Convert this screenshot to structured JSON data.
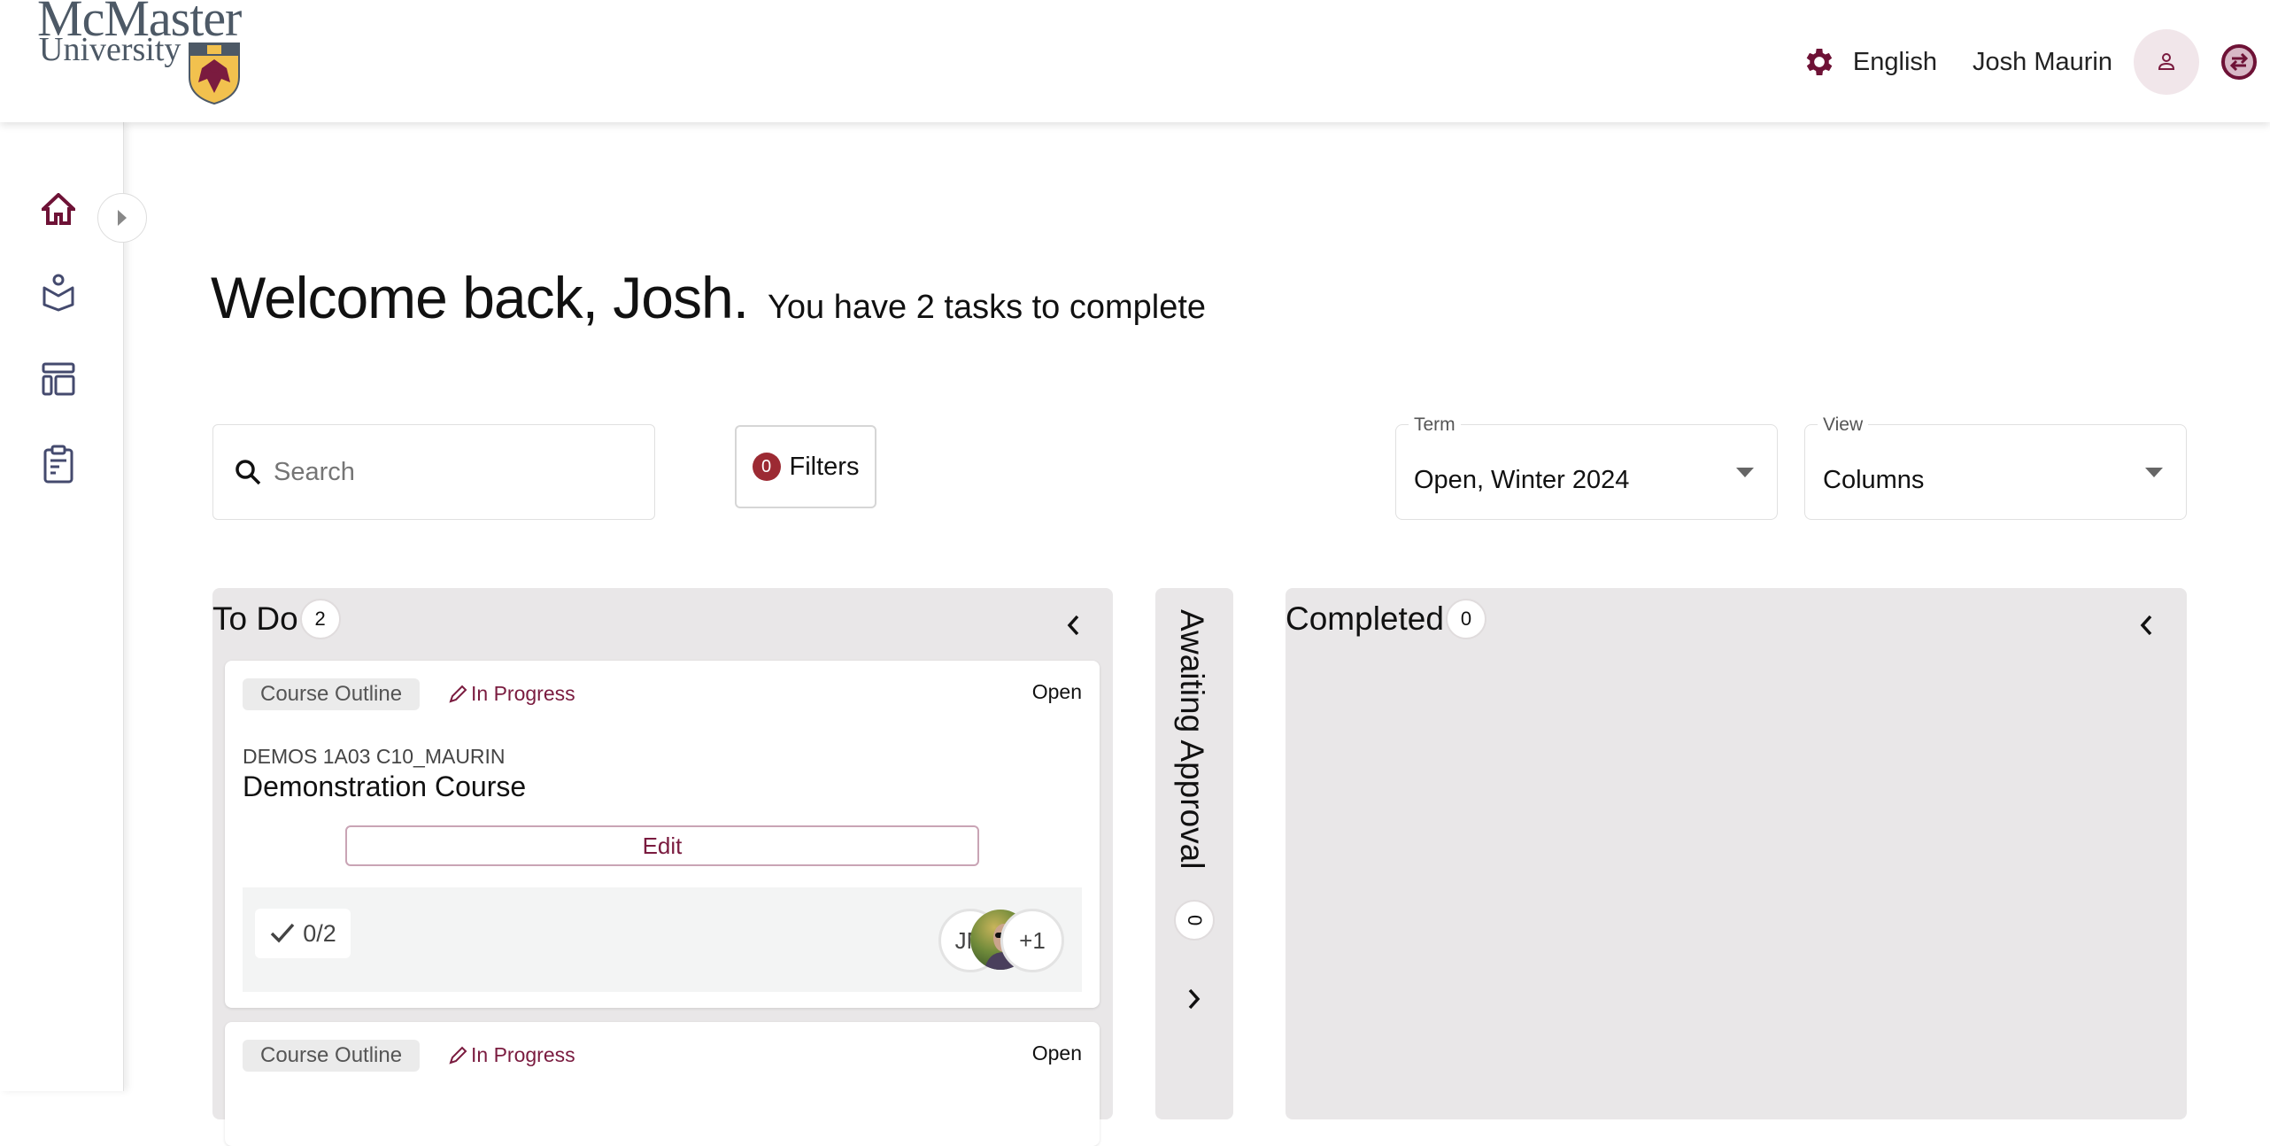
{
  "header": {
    "logo": {
      "line1": "McMaster",
      "line2": "University"
    },
    "settings_icon": "gear-icon",
    "language": "English",
    "user_name": "Josh Maurin",
    "profile_icon": "person-icon",
    "switch_icon": "swap-arrows-icon"
  },
  "sidebar": {
    "items": [
      {
        "name": "home",
        "icon": "home-icon",
        "active": true
      },
      {
        "name": "learning",
        "icon": "reader-book-icon",
        "active": false
      },
      {
        "name": "dashboard",
        "icon": "layout-icon",
        "active": false
      },
      {
        "name": "tasks",
        "icon": "clipboard-icon",
        "active": false
      }
    ],
    "expand_icon": "triangle-right-icon"
  },
  "main": {
    "welcome": "Welcome back, Josh.",
    "subtitle": "You have 2 tasks to complete",
    "search": {
      "placeholder": "Search",
      "value": ""
    },
    "filters": {
      "count": "0",
      "label": "Filters"
    },
    "term": {
      "label": "Term",
      "value": "Open, Winter 2024"
    },
    "view": {
      "label": "View",
      "value": "Columns"
    }
  },
  "columns": {
    "todo": {
      "title": "To Do",
      "count": "2",
      "cards": [
        {
          "tag": "Course Outline",
          "status": "In Progress",
          "state": "Open",
          "code": "DEMOS 1A03 C10_MAURIN",
          "name": "Demonstration Course",
          "action": "Edit",
          "progress": "0/2",
          "avatars": [
            {
              "initials": "JM"
            },
            {
              "type": "photo"
            },
            {
              "initials": "+1"
            }
          ]
        },
        {
          "tag": "Course Outline",
          "status": "In Progress",
          "state": "Open"
        }
      ]
    },
    "awaiting": {
      "title": "Awaiting Approval",
      "count": "0"
    },
    "completed": {
      "title": "Completed",
      "count": "0"
    }
  },
  "colors": {
    "brand": "#7a1b3f",
    "filter_badge": "#9c2a33",
    "column_bg": "#e9e7e8",
    "nav_icon": "#444a6e"
  }
}
